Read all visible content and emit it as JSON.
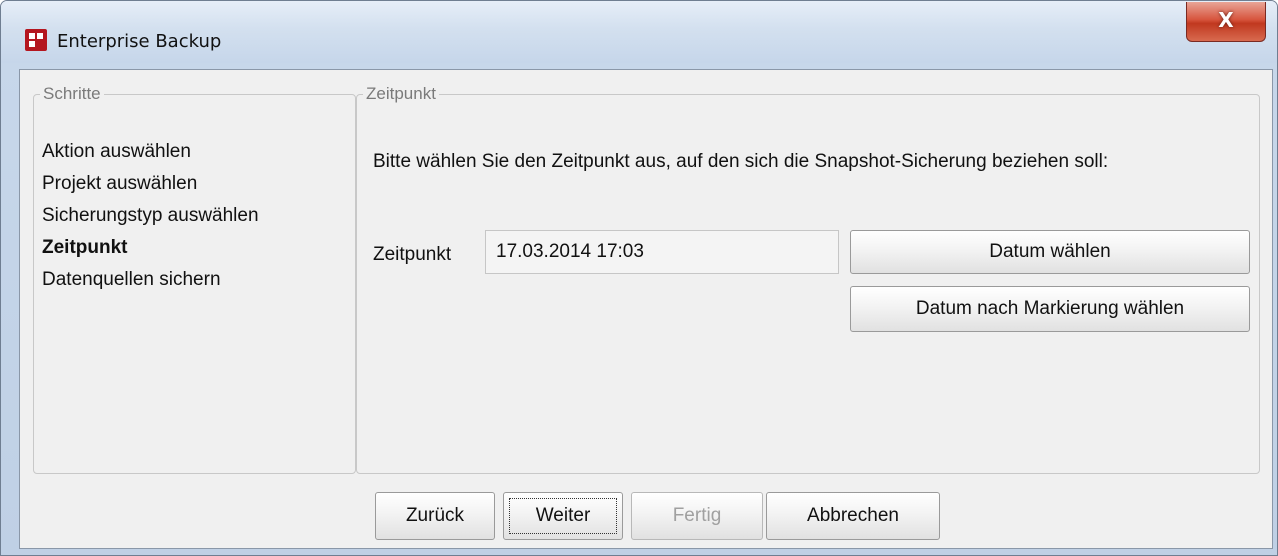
{
  "window": {
    "title": "Enterprise Backup",
    "close_label": "X",
    "app_icon": "firstspirit-app-icon",
    "close_icon": "close-icon"
  },
  "steps": {
    "legend": "Schritte",
    "items": [
      {
        "label": "Aktion auswählen",
        "active": false
      },
      {
        "label": "Projekt auswählen",
        "active": false
      },
      {
        "label": "Sicherungstyp auswählen",
        "active": false
      },
      {
        "label": "Zeitpunkt",
        "active": true
      },
      {
        "label": "Datenquellen sichern",
        "active": false
      }
    ]
  },
  "zeitpunkt": {
    "legend": "Zeitpunkt",
    "description": "Bitte wählen Sie den Zeitpunkt aus, auf den sich die Snapshot-Sicherung beziehen soll:",
    "field_label": "Zeitpunkt",
    "field_value": "17.03.2014 17:03",
    "choose_date_label": "Datum wählen",
    "choose_date_by_marker_label": "Datum nach Markierung wählen"
  },
  "footer": {
    "back_label": "Zurück",
    "next_label": "Weiter",
    "finish_label": "Fertig",
    "cancel_label": "Abbrechen"
  },
  "colors": {
    "app_icon": "#b4161f",
    "close_button": "#c9432a",
    "disabled_text": "#a0a0a0"
  }
}
